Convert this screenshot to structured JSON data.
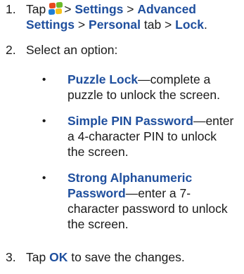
{
  "step1": {
    "number": "1.",
    "tap": "Tap",
    "logo_icon": "windows-start-icon",
    "sep1": ">",
    "settings": "Settings",
    "sep2": ">",
    "advanced_line1": "Advanced",
    "advanced_line2": "Settings",
    "sep3": ">",
    "personal": "Personal",
    "tab": "tab >",
    "lock": "Lock",
    "period": "."
  },
  "step2": {
    "number": "2.",
    "text": "Select an option:",
    "bullet": "•",
    "options": [
      {
        "title": "Puzzle Lock",
        "lines": [
          "—complete a",
          "puzzle to unlock the screen."
        ]
      },
      {
        "title": "Simple PIN Password",
        "lines": [
          "—enter",
          "a 4-character PIN to unlock",
          "the screen."
        ]
      },
      {
        "title_line1": "Strong Alphanumeric",
        "title_line2": "Password",
        "lines": [
          "—enter a 7-",
          "character password to unlock",
          "the screen."
        ]
      }
    ]
  },
  "step3": {
    "number": "3.",
    "tap": "Tap",
    "ok": "OK",
    "rest": "to save the changes."
  },
  "colors": {
    "keyword": "#1f4f9e",
    "text": "#1a1a1a",
    "logo": [
      "#e8491d",
      "#6cbb2a",
      "#1f7fd6",
      "#f7c21a"
    ]
  }
}
